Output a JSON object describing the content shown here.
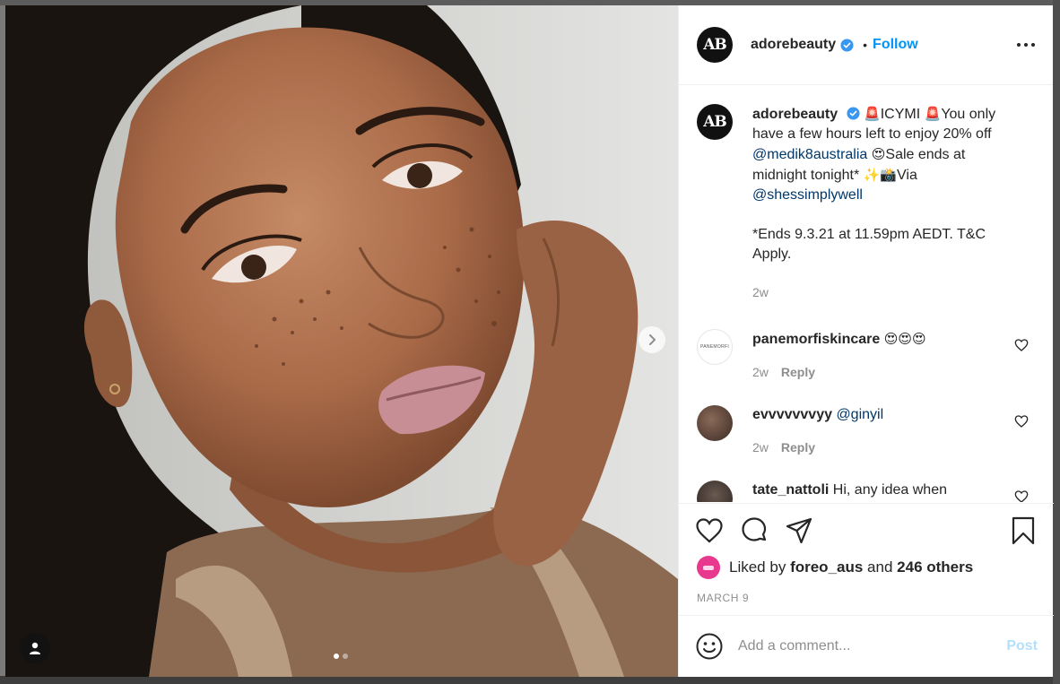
{
  "post": {
    "username": "adorebeauty",
    "avatar_initials": "AB",
    "follow_label": "Follow",
    "separator": "•"
  },
  "caption": {
    "username": "adorebeauty",
    "alarm_emoji": "🚨",
    "icymi": "ICYMI",
    "text1": "You only have a few hours left to enjoy 20% off",
    "mention1": "@medik8australia",
    "heart_eyes_emoji": "😍",
    "text2": "Sale ends at midnight tonight*",
    "sparkle_camera_emoji": "✨📸",
    "via": "Via",
    "mention2": "@shessimplywell",
    "terms": "*Ends 9.3.21 at 11.59pm AEDT. T&C Apply.",
    "time": "2w"
  },
  "comments": [
    {
      "username": "panemorfiskincare",
      "text": "😍😍😍",
      "time": "2w",
      "reply_label": "Reply",
      "avatar_text": "PANEMORFI"
    },
    {
      "username": "evvvvvvvyy",
      "mention": "@ginyil",
      "time": "2w",
      "reply_label": "Reply"
    },
    {
      "username": "tate_nattoli",
      "text": "Hi, any idea when"
    }
  ],
  "likes": {
    "prefix": "Liked by",
    "user": "foreo_aus",
    "and": "and",
    "others": "246 others"
  },
  "date": "MARCH 9",
  "add_comment": {
    "placeholder": "Add a comment...",
    "post_label": "Post"
  },
  "carousel": {
    "slides": 2,
    "current": 1
  },
  "colors": {
    "accent": "#0095f6",
    "mention": "#00376b",
    "muted": "#8e8e8e",
    "post_disabled": "#b2dffc"
  },
  "icons": [
    "verified-badge-icon",
    "more-options-icon",
    "heart-icon",
    "comment-icon",
    "share-icon",
    "bookmark-icon",
    "emoji-icon",
    "chevron-right-icon",
    "user-tag-icon"
  ]
}
